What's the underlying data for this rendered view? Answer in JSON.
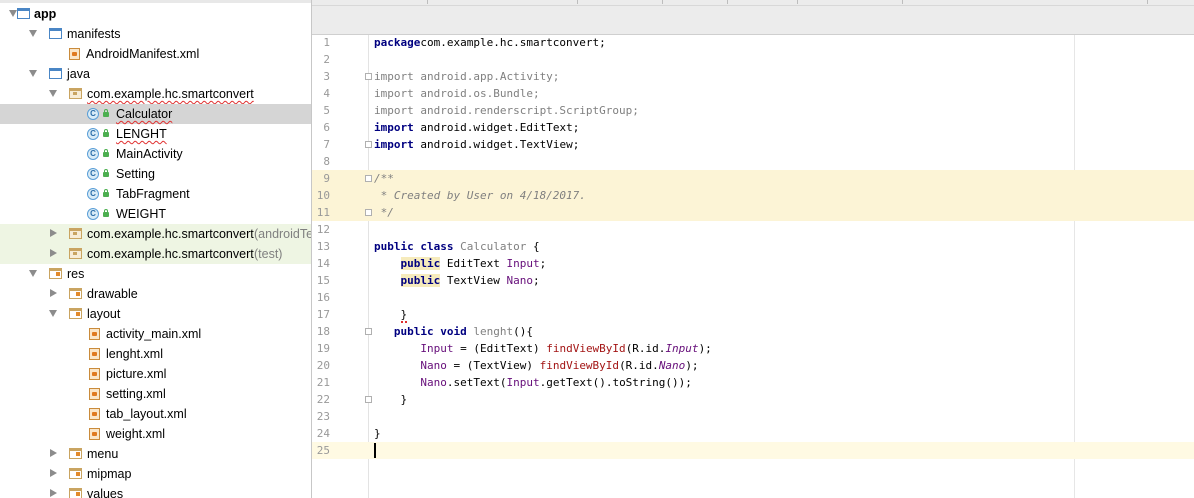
{
  "project_tree": {
    "items": [
      {
        "label": "app",
        "level": 0,
        "expanded": true,
        "icon": "module-folder-icon",
        "bold": true
      },
      {
        "label": "manifests",
        "level": 1,
        "expanded": true,
        "icon": "folder-icon"
      },
      {
        "label": "AndroidManifest.xml",
        "level": 2,
        "icon": "manifest-file-icon"
      },
      {
        "label": "java",
        "level": 1,
        "expanded": true,
        "icon": "folder-icon"
      },
      {
        "label": "com.example.hc.smartconvert",
        "level": 2,
        "expanded": true,
        "icon": "package-icon",
        "error": true
      },
      {
        "label": "Calculator",
        "level": 3,
        "icon": "class-icon",
        "selected": true,
        "error": true
      },
      {
        "label": "LENGHT",
        "level": 3,
        "icon": "class-icon",
        "error": true
      },
      {
        "label": "MainActivity",
        "level": 3,
        "icon": "class-icon"
      },
      {
        "label": "Setting",
        "level": 3,
        "icon": "class-icon"
      },
      {
        "label": "TabFragment",
        "level": 3,
        "icon": "class-icon"
      },
      {
        "label": "WEIGHT",
        "level": 3,
        "icon": "class-icon"
      },
      {
        "label": "com.example.hc.smartconvert",
        "suffix": "(androidTest)",
        "level": 2,
        "expanded": false,
        "icon": "package-icon",
        "tint": "green"
      },
      {
        "label": "com.example.hc.smartconvert",
        "suffix": "(test)",
        "level": 2,
        "expanded": false,
        "icon": "package-icon",
        "tint": "green"
      },
      {
        "label": "res",
        "level": 1,
        "expanded": true,
        "icon": "res-folder-icon"
      },
      {
        "label": "drawable",
        "level": 2,
        "expanded": false,
        "icon": "res-folder-icon"
      },
      {
        "label": "layout",
        "level": 2,
        "expanded": true,
        "icon": "res-folder-icon"
      },
      {
        "label": "activity_main.xml",
        "level": 3,
        "icon": "layout-file-icon"
      },
      {
        "label": "lenght.xml",
        "level": 3,
        "icon": "layout-file-icon"
      },
      {
        "label": "picture.xml",
        "level": 3,
        "icon": "layout-file-icon"
      },
      {
        "label": "setting.xml",
        "level": 3,
        "icon": "layout-file-icon"
      },
      {
        "label": "tab_layout.xml",
        "level": 3,
        "icon": "layout-file-icon"
      },
      {
        "label": "weight.xml",
        "level": 3,
        "icon": "layout-file-icon"
      },
      {
        "label": "menu",
        "level": 2,
        "expanded": false,
        "icon": "res-folder-icon"
      },
      {
        "label": "mipmap",
        "level": 2,
        "expanded": false,
        "icon": "res-folder-icon"
      },
      {
        "label": "values",
        "level": 2,
        "expanded": false,
        "icon": "res-folder-icon"
      }
    ]
  },
  "editor": {
    "lines": [
      {
        "n": "1",
        "seg": [
          [
            "kw",
            "package"
          ],
          [
            "",
            "com.example.hc.smartconvert;"
          ]
        ]
      },
      {
        "n": "2",
        "seg": []
      },
      {
        "n": "3",
        "fold": true,
        "seg": [
          [
            "imp",
            "import android.app.Activity;"
          ]
        ]
      },
      {
        "n": "4",
        "seg": [
          [
            "imp",
            "import android.os.Bundle;"
          ]
        ]
      },
      {
        "n": "5",
        "seg": [
          [
            "imp",
            "import android.renderscript.ScriptGroup;"
          ]
        ]
      },
      {
        "n": "6",
        "seg": [
          [
            "kw",
            "import"
          ],
          [
            "",
            " android.widget.EditText;"
          ]
        ]
      },
      {
        "n": "7",
        "fold": true,
        "seg": [
          [
            "kw",
            "import"
          ],
          [
            "",
            " android.widget.TextView;"
          ]
        ]
      },
      {
        "n": "8",
        "seg": []
      },
      {
        "n": "9",
        "fold": true,
        "hl": true,
        "seg": [
          [
            "cm",
            "/**"
          ]
        ]
      },
      {
        "n": "10",
        "hl": true,
        "seg": [
          [
            "cm",
            " * Created by User on 4/18/2017."
          ]
        ]
      },
      {
        "n": "11",
        "fold": true,
        "hl": true,
        "seg": [
          [
            "cm",
            " */"
          ]
        ]
      },
      {
        "n": "12",
        "seg": []
      },
      {
        "n": "13",
        "seg": [
          [
            "kw",
            "public class "
          ],
          [
            "unused",
            "Calculator"
          ],
          [
            "",
            " {"
          ]
        ]
      },
      {
        "n": "14",
        "seg": [
          [
            "",
            "    "
          ],
          [
            "warnkw kw",
            "public"
          ],
          [
            "",
            " EditText "
          ],
          [
            "fld",
            "Input"
          ],
          [
            "",
            ";"
          ]
        ]
      },
      {
        "n": "15",
        "seg": [
          [
            "",
            "    "
          ],
          [
            "warnkw kw",
            "public"
          ],
          [
            "",
            " TextView "
          ],
          [
            "fld",
            "Nano"
          ],
          [
            "",
            ";"
          ]
        ]
      },
      {
        "n": "16",
        "seg": []
      },
      {
        "n": "17",
        "seg": [
          [
            "",
            "    "
          ],
          [
            "errmark",
            "}"
          ]
        ]
      },
      {
        "n": "18",
        "fold": true,
        "seg": [
          [
            "",
            "   "
          ],
          [
            "kw",
            "public void "
          ],
          [
            "unused",
            "lenght"
          ],
          [
            "",
            "(){"
          ]
        ]
      },
      {
        "n": "19",
        "seg": [
          [
            "",
            "       "
          ],
          [
            "fld",
            "Input"
          ],
          [
            "",
            " = (EditText) "
          ],
          [
            "mth",
            "findViewById"
          ],
          [
            "",
            "(R.id."
          ],
          [
            "fldi",
            "Input"
          ],
          [
            "",
            ");"
          ]
        ]
      },
      {
        "n": "20",
        "seg": [
          [
            "",
            "       "
          ],
          [
            "fld",
            "Nano"
          ],
          [
            "",
            " = (TextView) "
          ],
          [
            "mth",
            "findViewById"
          ],
          [
            "",
            "(R.id."
          ],
          [
            "fldi",
            "Nano"
          ],
          [
            "",
            ");"
          ]
        ]
      },
      {
        "n": "21",
        "seg": [
          [
            "",
            "       "
          ],
          [
            "fld",
            "Nano"
          ],
          [
            "",
            ".setText("
          ],
          [
            "fld",
            "Input"
          ],
          [
            "",
            ".getText().toString());"
          ]
        ]
      },
      {
        "n": "22",
        "fold": true,
        "seg": [
          [
            "",
            "    }"
          ]
        ]
      },
      {
        "n": "23",
        "seg": []
      },
      {
        "n": "24",
        "seg": [
          [
            "",
            "}"
          ]
        ]
      },
      {
        "n": "25",
        "cur": true,
        "seg": []
      }
    ]
  }
}
